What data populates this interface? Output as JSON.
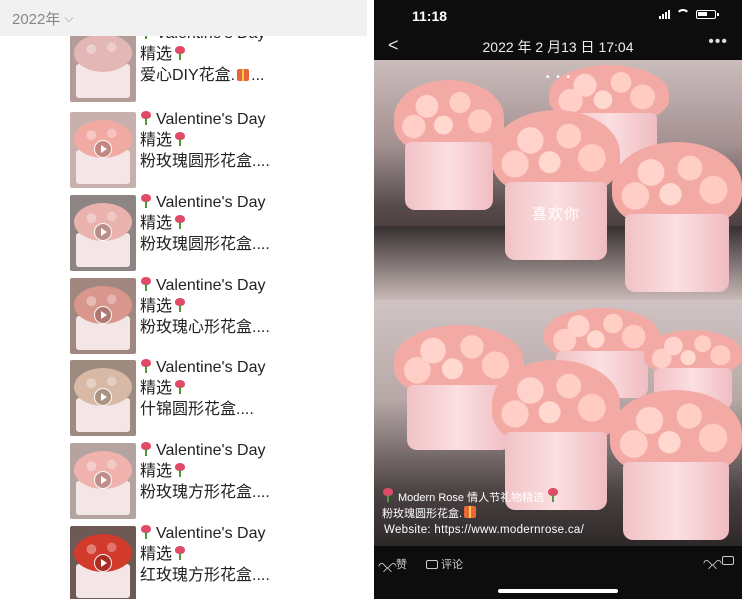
{
  "left": {
    "year_label": "2022年",
    "items": [
      {
        "line1": "Valentine's Day",
        "line2": "精选",
        "line3": "爱心DIY花盒.",
        "line3_suffix": "...",
        "has_gift": true,
        "has_play": false,
        "thumb_color": "#e2b7b6",
        "thumb_bg": "#b49c9b"
      },
      {
        "line1": "Valentine's Day",
        "line2": "精选",
        "line3": "粉玫瑰圆形花盒....",
        "line3_suffix": "",
        "has_gift": false,
        "has_play": true,
        "thumb_color": "#f1aaa2",
        "thumb_bg": "#c8b0ae"
      },
      {
        "line1": "Valentine's Day",
        "line2": "精选",
        "line3": "粉玫瑰圆形花盒....",
        "line3_suffix": "",
        "has_gift": false,
        "has_play": true,
        "thumb_color": "#e9b2ad",
        "thumb_bg": "#8d8583"
      },
      {
        "line1": "Valentine's Day",
        "line2": "精选",
        "line3": "粉玫瑰心形花盒....",
        "line3_suffix": "",
        "has_gift": false,
        "has_play": true,
        "thumb_color": "#d9968d",
        "thumb_bg": "#a08780"
      },
      {
        "line1": "Valentine's Day",
        "line2": "精选",
        "line3": "什锦圆形花盒....",
        "line3_suffix": "",
        "has_gift": false,
        "has_play": true,
        "thumb_color": "#d8b9a6",
        "thumb_bg": "#9c8b7e"
      },
      {
        "line1": "Valentine's Day",
        "line2": "精选",
        "line3": "粉玫瑰方形花盒....",
        "line3_suffix": "",
        "has_gift": false,
        "has_play": true,
        "thumb_color": "#f0b2ad",
        "thumb_bg": "#b3a4a0"
      },
      {
        "line1": "Valentine's Day",
        "line2": "精选",
        "line3": "红玫瑰方形花盒....",
        "line3_suffix": "",
        "has_gift": false,
        "has_play": true,
        "thumb_color": "#d23a2c",
        "thumb_bg": "#6e5a55"
      }
    ]
  },
  "right": {
    "time": "11:18",
    "post_date": "2022 年 2 月13 日 17:04",
    "box_label": "喜欢你",
    "caption_line1": "Modern Rose 情人节礼物精选",
    "caption_line2": "粉玫瑰圆形花盒.",
    "website": "Website:  https://www.modernrose.ca/",
    "like_label": "赞",
    "comment_label": "评论"
  }
}
